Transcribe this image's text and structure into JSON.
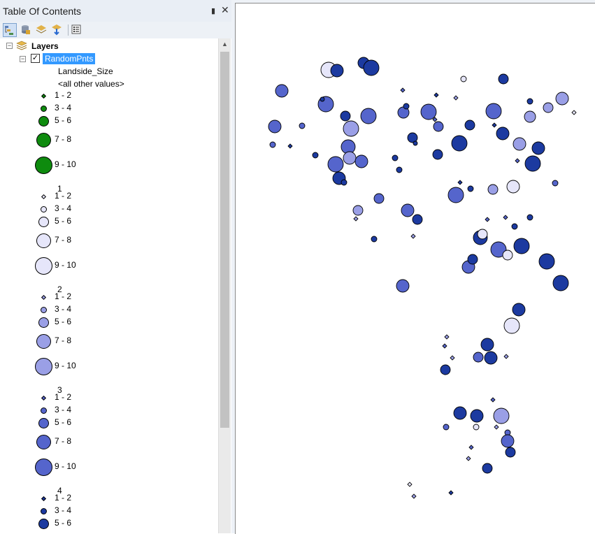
{
  "toc": {
    "title": "Table Of Contents",
    "pin_icon": "pin-icon",
    "close_icon": "close-icon",
    "toolbar_icons": [
      "list-by-drawing-order-icon",
      "list-by-source-icon",
      "list-by-visibility-icon",
      "list-by-selection-icon",
      "options-icon"
    ],
    "layers_label": "Layers",
    "layer_name": "RandomPnts",
    "layer_checked": true,
    "field_name": "Landside_Size",
    "other_values": "<all other values>",
    "groups": [
      {
        "heading": "",
        "color": "#0e8b0e",
        "classes": [
          "1 - 2",
          "3 - 4",
          "5 - 6",
          "7 - 8",
          "9 - 10"
        ]
      },
      {
        "heading": "1",
        "color": "#e6e6fa",
        "classes": [
          "1 - 2",
          "3 - 4",
          "5 - 6",
          "7 - 8",
          "9 - 10"
        ]
      },
      {
        "heading": "2",
        "color": "#9a9fe6",
        "classes": [
          "1 - 2",
          "3 - 4",
          "5 - 6",
          "7 - 8",
          "9 - 10"
        ]
      },
      {
        "heading": "3",
        "color": "#5565cc",
        "classes": [
          "1 - 2",
          "3 - 4",
          "5 - 6",
          "7 - 8",
          "9 - 10"
        ]
      },
      {
        "heading": "4",
        "color": "#1c3aa0",
        "classes": [
          "1 - 2",
          "3 - 4",
          "5 - 6"
        ]
      }
    ]
  },
  "map": {
    "palette": [
      "#e6e6fa",
      "#9a9fe6",
      "#5565cc",
      "#1c3aa0",
      "#0b2f8a"
    ],
    "points": [
      [
        469,
        99,
        11,
        0
      ],
      [
        481,
        100,
        9,
        3
      ],
      [
        519,
        89,
        8,
        3
      ],
      [
        530,
        96,
        11,
        3
      ],
      [
        402,
        129,
        9,
        2
      ],
      [
        465,
        148,
        11,
        2
      ],
      [
        460,
        141,
        3,
        3
      ],
      [
        392,
        180,
        9,
        2
      ],
      [
        431,
        179,
        4,
        2
      ],
      [
        389,
        206,
        4,
        2
      ],
      [
        414,
        208,
        2,
        3
      ],
      [
        450,
        221,
        4,
        3
      ],
      [
        493,
        165,
        7,
        3
      ],
      [
        526,
        165,
        11,
        2
      ],
      [
        501,
        183,
        11,
        1
      ],
      [
        497,
        209,
        10,
        2
      ],
      [
        499,
        225,
        9,
        1
      ],
      [
        479,
        234,
        11,
        2
      ],
      [
        484,
        254,
        9,
        3
      ],
      [
        491,
        260,
        4,
        3
      ],
      [
        516,
        230,
        9,
        2
      ],
      [
        541,
        283,
        7,
        2
      ],
      [
        511,
        300,
        7,
        1
      ],
      [
        508,
        312,
        2,
        1
      ],
      [
        534,
        341,
        4,
        3
      ],
      [
        575,
        128,
        2,
        2
      ],
      [
        576,
        160,
        8,
        2
      ],
      [
        580,
        151,
        4,
        3
      ],
      [
        612,
        159,
        11,
        2
      ],
      [
        623,
        135,
        2,
        3
      ],
      [
        651,
        139,
        2,
        1
      ],
      [
        662,
        112,
        4,
        0
      ],
      [
        719,
        112,
        7,
        3
      ],
      [
        757,
        144,
        4,
        3
      ],
      [
        757,
        166,
        8,
        1
      ],
      [
        783,
        153,
        7,
        1
      ],
      [
        803,
        140,
        9,
        1
      ],
      [
        820,
        160,
        2,
        0
      ],
      [
        626,
        180,
        7,
        2
      ],
      [
        621,
        170,
        2,
        2
      ],
      [
        671,
        178,
        7,
        3
      ],
      [
        589,
        196,
        7,
        3
      ],
      [
        593,
        204,
        3,
        3
      ],
      [
        656,
        204,
        11,
        3
      ],
      [
        625,
        220,
        7,
        3
      ],
      [
        564,
        225,
        4,
        3
      ],
      [
        570,
        242,
        4,
        3
      ],
      [
        705,
        158,
        11,
        2
      ],
      [
        718,
        190,
        9,
        3
      ],
      [
        706,
        178,
        2,
        3
      ],
      [
        742,
        205,
        9,
        1
      ],
      [
        769,
        211,
        9,
        3
      ],
      [
        761,
        233,
        11,
        3
      ],
      [
        739,
        229,
        2,
        2
      ],
      [
        651,
        278,
        11,
        2
      ],
      [
        657,
        260,
        2,
        3
      ],
      [
        672,
        269,
        4,
        3
      ],
      [
        704,
        270,
        7,
        1
      ],
      [
        733,
        266,
        9,
        0
      ],
      [
        793,
        261,
        4,
        2
      ],
      [
        582,
        300,
        9,
        2
      ],
      [
        596,
        313,
        7,
        3
      ],
      [
        590,
        337,
        2,
        1
      ],
      [
        686,
        339,
        10,
        3
      ],
      [
        689,
        334,
        7,
        0
      ],
      [
        696,
        313,
        2,
        2
      ],
      [
        722,
        310,
        2,
        2
      ],
      [
        735,
        323,
        4,
        3
      ],
      [
        757,
        310,
        4,
        3
      ],
      [
        712,
        356,
        11,
        2
      ],
      [
        725,
        364,
        7,
        0
      ],
      [
        745,
        351,
        11,
        3
      ],
      [
        669,
        381,
        9,
        2
      ],
      [
        675,
        370,
        7,
        3
      ],
      [
        781,
        373,
        11,
        3
      ],
      [
        801,
        404,
        11,
        3
      ],
      [
        575,
        408,
        9,
        2
      ],
      [
        741,
        442,
        9,
        3
      ],
      [
        731,
        465,
        11,
        0
      ],
      [
        638,
        481,
        2,
        1
      ],
      [
        635,
        494,
        2,
        2
      ],
      [
        646,
        511,
        2,
        1
      ],
      [
        696,
        492,
        9,
        3
      ],
      [
        683,
        510,
        7,
        2
      ],
      [
        701,
        511,
        9,
        3
      ],
      [
        723,
        509,
        2,
        1
      ],
      [
        636,
        528,
        7,
        3
      ],
      [
        704,
        571,
        2,
        2
      ],
      [
        657,
        590,
        9,
        3
      ],
      [
        681,
        594,
        9,
        3
      ],
      [
        716,
        594,
        11,
        1
      ],
      [
        680,
        610,
        4,
        0
      ],
      [
        637,
        610,
        4,
        2
      ],
      [
        709,
        610,
        2,
        1
      ],
      [
        725,
        618,
        4,
        2
      ],
      [
        725,
        630,
        9,
        2
      ],
      [
        729,
        646,
        7,
        3
      ],
      [
        673,
        639,
        2,
        2
      ],
      [
        669,
        655,
        2,
        1
      ],
      [
        696,
        669,
        7,
        3
      ],
      [
        585,
        692,
        2,
        0
      ],
      [
        644,
        704,
        2,
        3
      ],
      [
        591,
        709,
        2,
        1
      ]
    ]
  }
}
